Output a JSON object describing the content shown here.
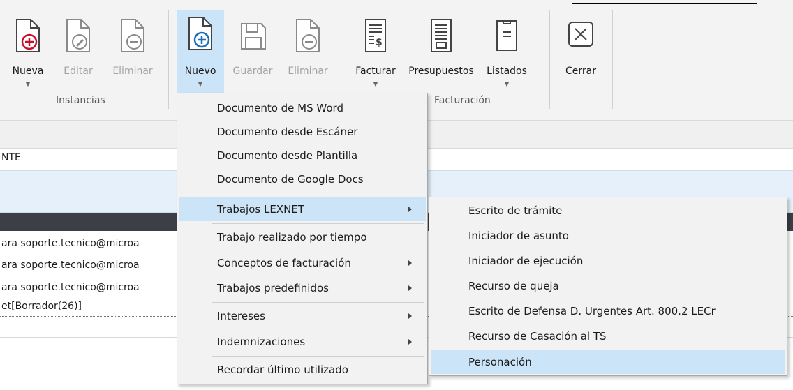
{
  "ribbon": {
    "instancias": {
      "group_label": "Instancias",
      "buttons": [
        {
          "label": "Nueva",
          "icon": "doc-plus-red-icon",
          "disabled": false,
          "dropdown": true
        },
        {
          "label": "Editar",
          "icon": "doc-edit-icon",
          "disabled": true,
          "dropdown": false
        },
        {
          "label": "Eliminar",
          "icon": "doc-minus-icon",
          "disabled": true,
          "dropdown": false
        }
      ]
    },
    "documentos": {
      "buttons": [
        {
          "label": "Nuevo",
          "icon": "doc-plus-blue-icon",
          "disabled": false,
          "dropdown": true,
          "selected": true
        },
        {
          "label": "Guardar",
          "icon": "save-icon",
          "disabled": true,
          "dropdown": false
        },
        {
          "label": "Eliminar",
          "icon": "doc-minus-icon",
          "disabled": true,
          "dropdown": false
        }
      ]
    },
    "facturacion": {
      "group_label": "Facturación",
      "buttons": [
        {
          "label": "Facturar",
          "icon": "invoice-icon",
          "dropdown": true
        },
        {
          "label": "Presupuestos",
          "icon": "budget-icon",
          "dropdown": false
        },
        {
          "label": "Listados",
          "icon": "list-icon",
          "dropdown": true
        }
      ]
    },
    "cerrar": {
      "label": "Cerrar",
      "icon": "close-icon"
    }
  },
  "content": {
    "column_header": "NTE",
    "rows": [
      "ara soporte.tecnico@microa",
      "ara soporte.tecnico@microa",
      "ara soporte.tecnico@microa",
      "et[Borrador(26)]"
    ]
  },
  "nuevo_menu": {
    "items": [
      {
        "label": "Documento de MS Word",
        "submenu": false
      },
      {
        "label": "Documento desde Escáner",
        "submenu": false
      },
      {
        "label": "Documento desde Plantilla",
        "submenu": false
      },
      {
        "label": "Documento de Google Docs",
        "submenu": false
      },
      {
        "label": "Trabajos LEXNET",
        "submenu": true,
        "highlighted": true
      },
      {
        "label": "Trabajo realizado por tiempo",
        "submenu": false
      },
      {
        "label": "Conceptos de facturación",
        "submenu": true
      },
      {
        "label": "Trabajos predefinidos",
        "submenu": true
      },
      {
        "label": "Intereses",
        "submenu": true
      },
      {
        "label": "Indemnizaciones",
        "submenu": true
      },
      {
        "label": "Recordar último utilizado",
        "submenu": false
      }
    ]
  },
  "lexnet_submenu": {
    "items": [
      {
        "label": "Escrito de trámite"
      },
      {
        "label": "Iniciador de asunto"
      },
      {
        "label": "Iniciador de ejecución"
      },
      {
        "label": "Recurso de queja"
      },
      {
        "label": "Escrito de Defensa D. Urgentes Art. 800.2 LECr"
      },
      {
        "label": "Recurso de Casación al TS"
      },
      {
        "label": "Personación",
        "highlighted": true
      }
    ]
  },
  "colors": {
    "selection": "#cce4f7",
    "accent_red": "#c8102e",
    "accent_blue": "#1f6fb5"
  }
}
